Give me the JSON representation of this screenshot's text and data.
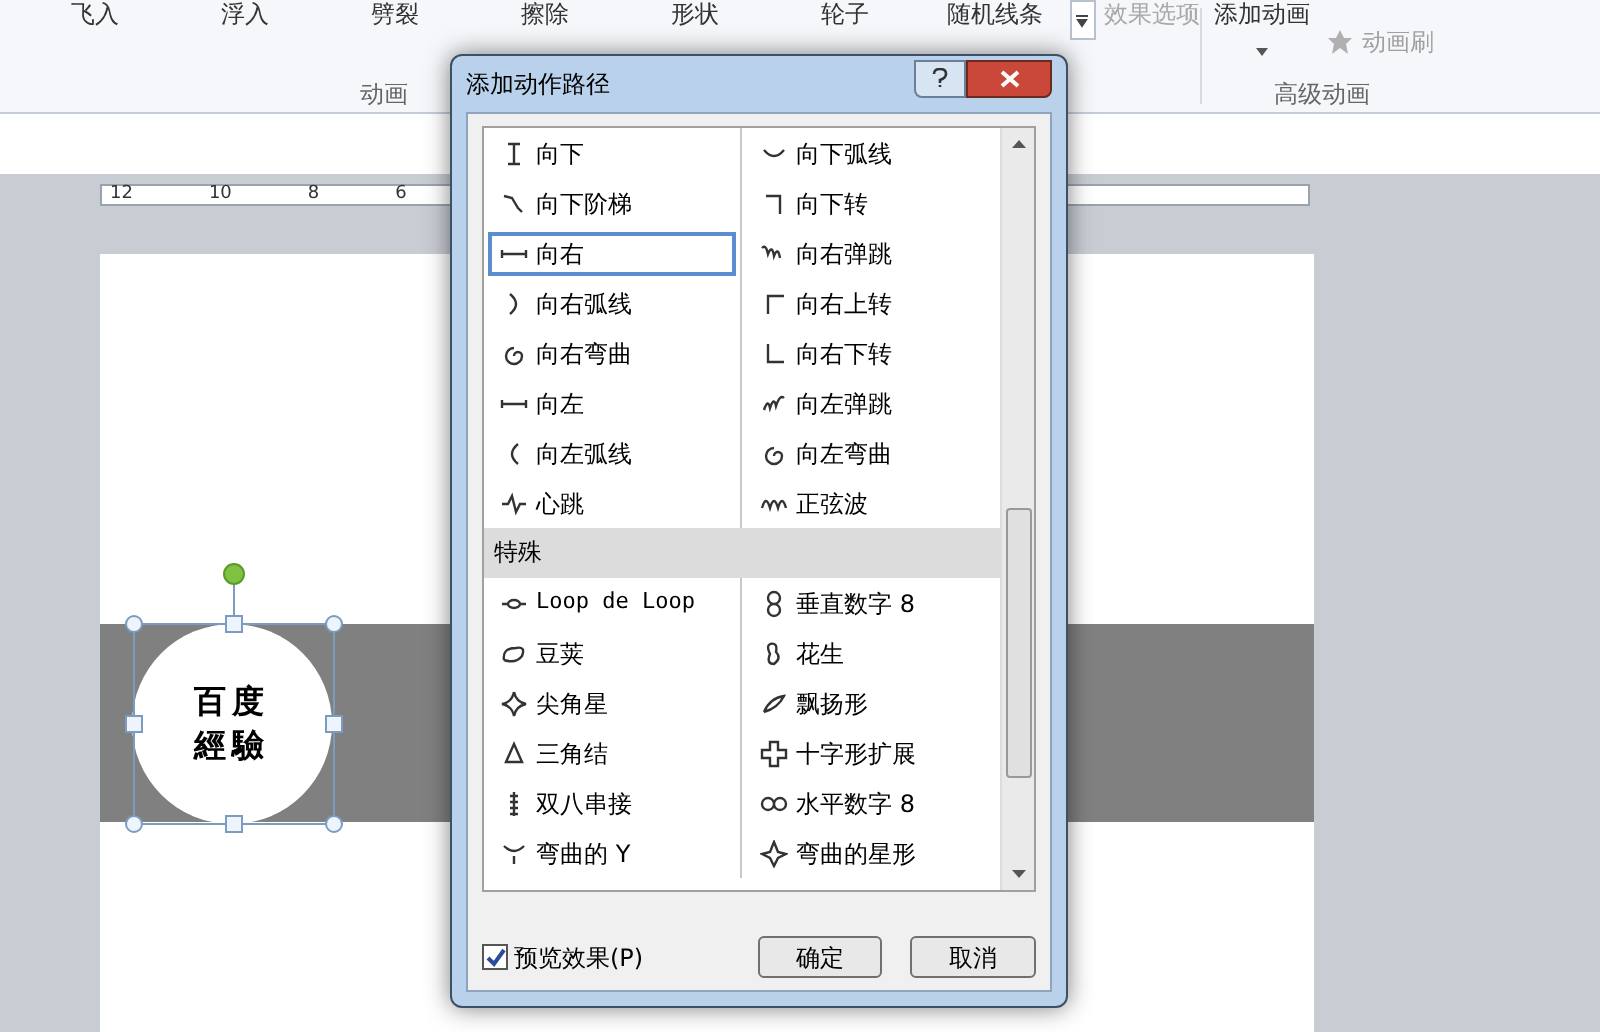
{
  "ribbon": {
    "gallery": [
      "飞入",
      "浮入",
      "劈裂",
      "擦除",
      "形状",
      "轮子",
      "随机线条"
    ],
    "effect_options": {
      "label": "效果选项",
      "disabled": true
    },
    "add_animation": "添加动画",
    "painter": {
      "label": "动画刷",
      "disabled": true
    },
    "groups": [
      "动画",
      "高级动画"
    ]
  },
  "ruler": {
    "labels": [
      "12",
      "10",
      "8",
      "6"
    ]
  },
  "slide": {
    "text_lines": [
      "百度",
      "經驗"
    ]
  },
  "dialog": {
    "title": "添加动作路径",
    "sections": [
      {
        "items": [
          {
            "label": "向下",
            "selected": false
          },
          {
            "label": "向下弧线",
            "selected": false
          },
          {
            "label": "向下阶梯",
            "selected": false
          },
          {
            "label": "向下转",
            "selected": false
          },
          {
            "label": "向右",
            "selected": true
          },
          {
            "label": "向右弹跳",
            "selected": false
          },
          {
            "label": "向右弧线",
            "selected": false
          },
          {
            "label": "向右上转",
            "selected": false
          },
          {
            "label": "向右弯曲",
            "selected": false
          },
          {
            "label": "向右下转",
            "selected": false
          },
          {
            "label": "向左",
            "selected": false
          },
          {
            "label": "向左弹跳",
            "selected": false
          },
          {
            "label": "向左弧线",
            "selected": false
          },
          {
            "label": "向左弯曲",
            "selected": false
          },
          {
            "label": "心跳",
            "selected": false
          },
          {
            "label": "正弦波",
            "selected": false
          }
        ]
      },
      {
        "header": "特殊",
        "items": [
          {
            "label": "Loop de Loop",
            "selected": false
          },
          {
            "label": "垂直数字 8",
            "selected": false
          },
          {
            "label": "豆荚",
            "selected": false
          },
          {
            "label": "花生",
            "selected": false
          },
          {
            "label": "尖角星",
            "selected": false
          },
          {
            "label": "飘扬形",
            "selected": false
          },
          {
            "label": "三角结",
            "selected": false
          },
          {
            "label": "十字形扩展",
            "selected": false
          },
          {
            "label": "双八串接",
            "selected": false
          },
          {
            "label": "水平数字 8",
            "selected": false
          },
          {
            "label": "弯曲的 Y",
            "selected": false
          },
          {
            "label": "弯曲的星形",
            "selected": false
          }
        ]
      }
    ],
    "preview": {
      "label": "预览效果(P)",
      "checked": true
    },
    "buttons": [
      "确定",
      "取消"
    ]
  }
}
